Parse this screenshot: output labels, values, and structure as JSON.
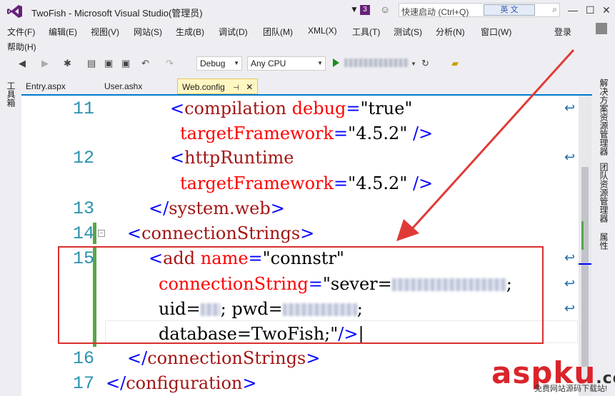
{
  "window": {
    "title": "TwoFish - Microsoft Visual Studio(管理员)",
    "notification_count": "3",
    "quick_launch_placeholder": "快速启动 (Ctrl+Q)",
    "ime_label": "英 文",
    "minimize": "—",
    "maximize": "☐",
    "close": "✕"
  },
  "menu": {
    "items": [
      "文件(F)",
      "编辑(E)",
      "视图(V)",
      "网站(S)",
      "生成(B)",
      "调试(D)",
      "团队(M)",
      "XML(X)",
      "工具(T)",
      "测试(S)",
      "分析(N)",
      "窗口(W)",
      "帮助(H)"
    ],
    "login": "登录"
  },
  "toolbar": {
    "config": "Debug",
    "platform": "Any CPU"
  },
  "left_rail": {
    "label": "工具箱"
  },
  "right_rail": {
    "labels": [
      "解决方案资源管理器",
      "团队资源管理器",
      "属性"
    ]
  },
  "tabs": [
    {
      "label": "Entry.aspx"
    },
    {
      "label": "User.ashx"
    },
    {
      "label": "Web.config",
      "active": true
    }
  ],
  "editor": {
    "line_numbers": [
      "11",
      "12",
      "13",
      "14",
      "15",
      "16",
      "17"
    ],
    "lines": {
      "l11a": [
        "<",
        "compilation",
        " ",
        "debug",
        "=",
        "\"true\""
      ],
      "l11b": [
        "targetFramework",
        "=",
        "\"4.5.2\"",
        " />"
      ],
      "l12a": [
        "<",
        "httpRuntime"
      ],
      "l12b": [
        "targetFramework",
        "=",
        "\"4.5.2\"",
        " />"
      ],
      "l13": [
        "</",
        "system.web",
        ">"
      ],
      "l14": [
        "<",
        "connectionStrings",
        ">"
      ],
      "l15a": [
        "<",
        "add",
        " ",
        "name",
        "=",
        "\"connstr\""
      ],
      "l15b": [
        "connectionString",
        "=",
        "\"sever=",
        ";"
      ],
      "l15c": [
        "uid=",
        "; pwd=",
        ";"
      ],
      "l15d": [
        "database=TwoFish;\"",
        "/>"
      ],
      "l16": [
        "</",
        "connectionStrings",
        ">"
      ],
      "l17": [
        "</",
        "configuration",
        ">"
      ]
    }
  },
  "watermark": {
    "brand": "aspku",
    "suffix": ".com",
    "tagline": "免费网站源码下载站!"
  },
  "colors": {
    "accent": "#007acc",
    "annotation": "#d9302e",
    "line_number": "#2b91af"
  }
}
